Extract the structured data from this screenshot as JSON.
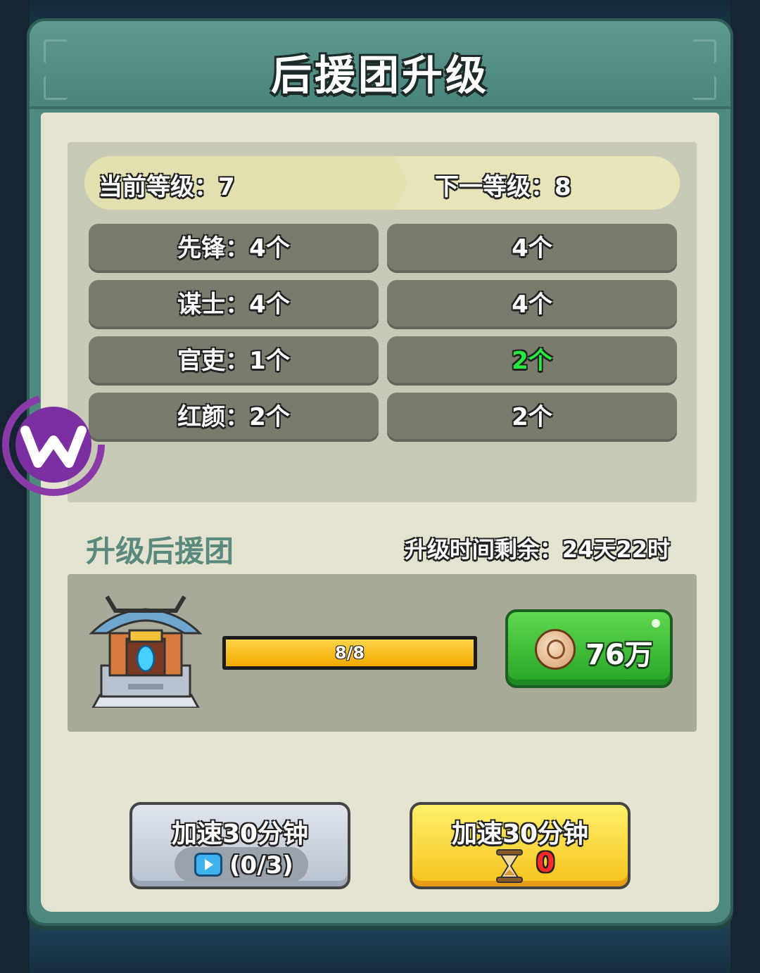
{
  "header": {
    "title": "后援团升级"
  },
  "levels": {
    "current": "当前等级：7",
    "next": "下一等级：8"
  },
  "stats": [
    {
      "current": "先锋：4个",
      "next": "4个",
      "highlight": false
    },
    {
      "current": "谋士：4个",
      "next": "4个",
      "highlight": false
    },
    {
      "current": "官吏：1个",
      "next": "2个",
      "highlight": true
    },
    {
      "current": "红颜：2个",
      "next": "2个",
      "highlight": false
    }
  ],
  "upgrade": {
    "section_title": "升级后援团",
    "time_left": "升级时间剩余：24天22时",
    "progress_text": "8/8",
    "progress": 1.0,
    "cost": "76万",
    "cost_icon": "coin-icon"
  },
  "speedup": {
    "ad_label": "加速30分钟",
    "ad_count": "(0/3)",
    "ad_icon": "tv-ad-icon",
    "item_label": "加速30分钟",
    "item_count": "0",
    "item_icon": "hourglass-icon"
  },
  "colors": {
    "panel_teal": "#4f8a80",
    "body_cream": "#e3e3cf",
    "stat_cell": "#7a7b6d",
    "highlight_green": "#28e93f",
    "cost_button": "#26a427",
    "item_button": "#f6c21c",
    "count_red": "#ff2a2a"
  }
}
